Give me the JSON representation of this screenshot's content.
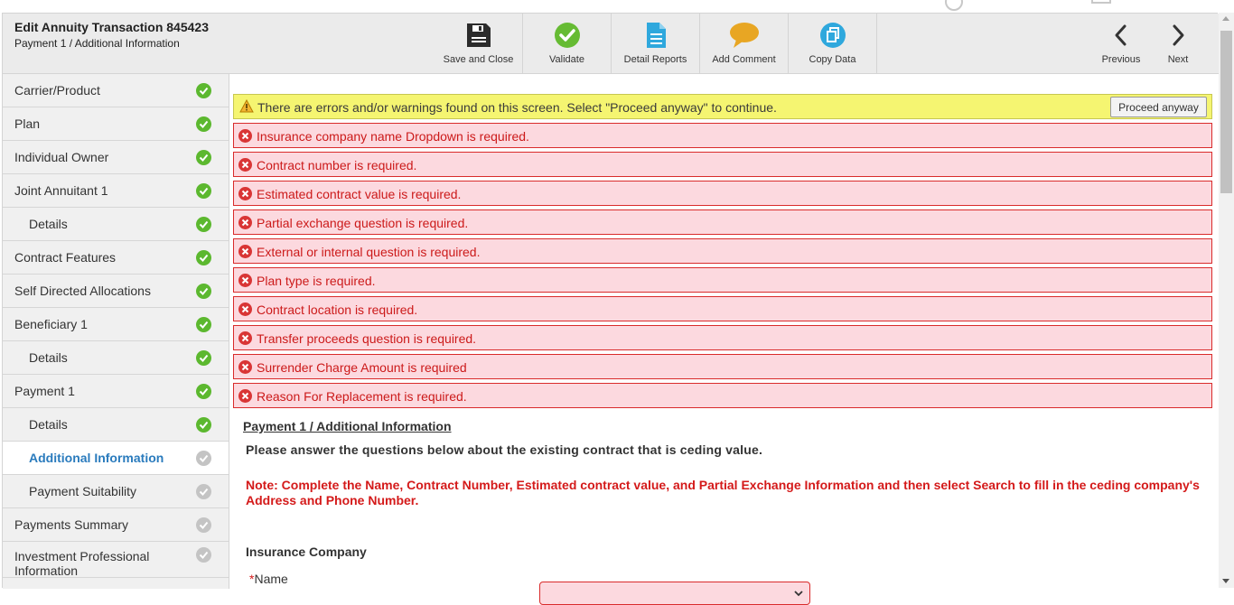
{
  "header": {
    "title": "Edit Annuity Transaction 845423",
    "subtitle": "Payment 1 / Additional Information"
  },
  "toolbar": {
    "save_close": "Save and Close",
    "validate": "Validate",
    "detail_reports": "Detail Reports",
    "add_comment": "Add Comment",
    "copy_data": "Copy Data",
    "previous": "Previous",
    "next": "Next"
  },
  "sidebar": {
    "items": [
      {
        "label": "Carrier/Product",
        "status": "complete"
      },
      {
        "label": "Plan",
        "status": "complete"
      },
      {
        "label": "Individual Owner",
        "status": "complete"
      },
      {
        "label": "Joint Annuitant 1",
        "status": "complete"
      },
      {
        "label": "Details",
        "status": "complete"
      },
      {
        "label": "Contract Features",
        "status": "complete"
      },
      {
        "label": "Self Directed Allocations",
        "status": "complete"
      },
      {
        "label": "Beneficiary 1",
        "status": "complete"
      },
      {
        "label": "Details",
        "status": "complete"
      },
      {
        "label": "Payment 1",
        "status": "complete"
      },
      {
        "label": "Details",
        "status": "complete"
      },
      {
        "label": "Additional Information",
        "status": "incomplete"
      },
      {
        "label": "Payment Suitability",
        "status": "incomplete"
      },
      {
        "label": "Payments Summary",
        "status": "incomplete"
      },
      {
        "label": "Investment Professional Information",
        "status": "incomplete"
      }
    ]
  },
  "warning": {
    "message": "There are errors and/or warnings found on this screen. Select \"Proceed anyway\" to continue.",
    "button": "Proceed anyway"
  },
  "errors": [
    "Insurance company name Dropdown is required.",
    "Contract number is required.",
    "Estimated contract value is required.",
    "Partial exchange question is required.",
    "External or internal question is required.",
    "Plan type is required.",
    "Contract location is required.",
    "Transfer proceeds question is required.",
    "Surrender Charge Amount is required",
    "Reason For Replacement is required."
  ],
  "main": {
    "section_title": "Payment 1 / Additional Information",
    "intro": "Please answer the questions below about the existing contract that is ceding value.",
    "note": "Note: Complete the Name, Contract Number, Estimated contract value, and Partial Exchange Information and then select Search to fill in the ceding company's Address and Phone Number.",
    "group_title": "Insurance Company",
    "name_required_mark": "*",
    "name_label": "Name",
    "name_value": ""
  },
  "colors": {
    "complete": "#5cb82f",
    "incomplete": "#c4c4c4",
    "error_bg": "#fcd9df",
    "error_text": "#cc1a1a",
    "warning_bg": "#f5f571",
    "active_link": "#2a7bbd"
  }
}
